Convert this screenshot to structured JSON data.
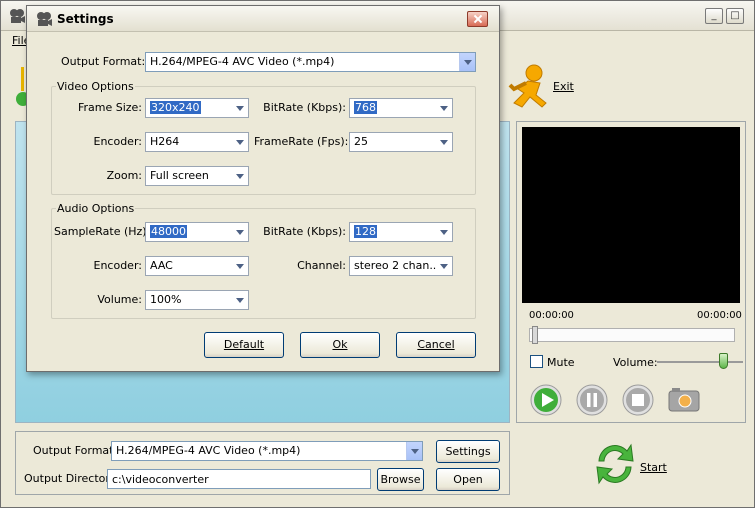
{
  "main": {
    "menu": {
      "file": "File"
    },
    "exit_label": "Exit",
    "player": {
      "time_start": "00:00:00",
      "time_end": "00:00:00",
      "mute_label": "Mute",
      "mute_checked": false,
      "volume_label": "Volume:",
      "volume_level_pct": 80
    },
    "bottom": {
      "output_format_label": "Output Format:",
      "output_format_value": "H.264/MPEG-4 AVC Video (*.mp4)",
      "settings_button": "Settings",
      "output_directory_label": "Output Directory:",
      "output_directory_value": "c:\\videoconverter",
      "browse_button": "Browse",
      "open_button": "Open"
    },
    "start_label": "Start"
  },
  "dialog": {
    "title": "Settings",
    "output_format_label": "Output Format:",
    "output_format_value": "H.264/MPEG-4 AVC Video (*.mp4)",
    "video_options": {
      "title": "Video Options",
      "frame_size_label": "Frame Size:",
      "frame_size_value": "320x240",
      "bitrate_label": "BitRate (Kbps):",
      "bitrate_value": "768",
      "encoder_label": "Encoder:",
      "encoder_value": "H264",
      "framerate_label": "FrameRate (Fps):",
      "framerate_value": "25",
      "zoom_label": "Zoom:",
      "zoom_value": "Full screen"
    },
    "audio_options": {
      "title": "Audio Options",
      "samplerate_label": "SampleRate (Hz):",
      "samplerate_value": "48000",
      "bitrate_label": "BitRate (Kbps):",
      "bitrate_value": "128",
      "encoder_label": "Encoder:",
      "encoder_value": "AAC",
      "channel_label": "Channel:",
      "channel_value": "stereo 2 chan...",
      "volume_label": "Volume:",
      "volume_value": "100%"
    },
    "buttons": {
      "default": "Default",
      "ok": "Ok",
      "cancel": "Cancel"
    }
  },
  "colors": {
    "accent_blue": "#316ac5",
    "preview_bg": "#a9d9e7",
    "play_green": "#3fae3a",
    "video_bg": "#000000"
  }
}
